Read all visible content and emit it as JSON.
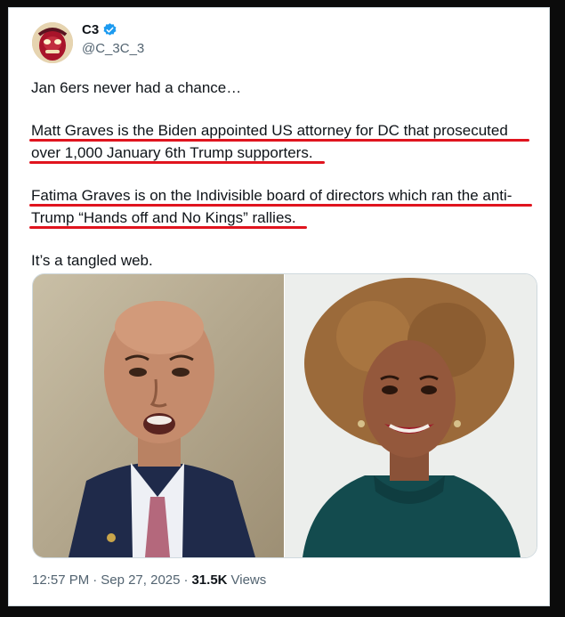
{
  "tweet": {
    "display_name": "C3",
    "handle": "@C_3C_3",
    "verified_icon": "verified-badge-icon",
    "lines": {
      "l1": "Jan 6ers never had a chance…",
      "p2a": "Matt Graves is the Biden appointed US attorney for DC that prosecuted",
      "p2b": "over 1,000 January 6th Trump supporters.",
      "p3a": "Fatima Graves is on the Indivisible board of directors which ran the anti-",
      "p3b": "Trump “Hands off and No Kings” rallies.",
      "l4": "It’s a tangled web."
    },
    "time": "12:57 PM",
    "date": "Sep 27, 2025",
    "views_count": "31.5K",
    "views_label": "Views",
    "separator": "·"
  },
  "colors": {
    "underline": "#e0141e",
    "verified": "#1d9bf0",
    "muted": "#536471",
    "text": "#0f1419"
  }
}
